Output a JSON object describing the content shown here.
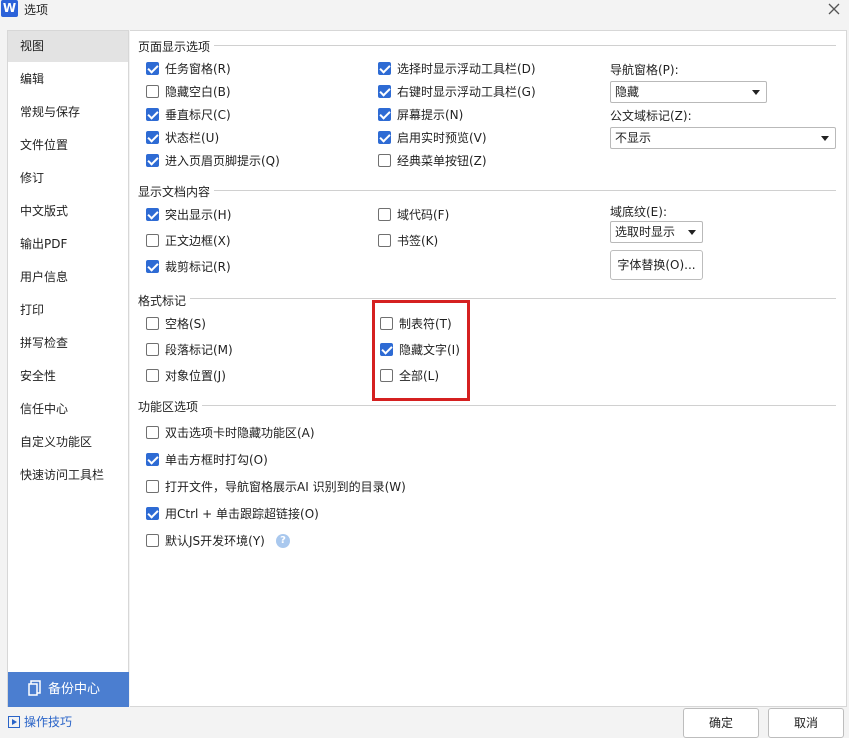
{
  "window": {
    "logo": "W",
    "title": "选项"
  },
  "sidebar": {
    "items": [
      "视图",
      "编辑",
      "常规与保存",
      "文件位置",
      "修订",
      "中文版式",
      "输出PDF",
      "用户信息",
      "打印",
      "拼写检查",
      "安全性",
      "信任中心",
      "自定义功能区",
      "快速访问工具栏"
    ],
    "active_index": 0,
    "backup_label": "备份中心",
    "tips_label": "操作技巧"
  },
  "sections": {
    "page_display": "页面显示选项",
    "doc_content": "显示文档内容",
    "format_marks": "格式标记",
    "ribbon": "功能区选项"
  },
  "page_display": {
    "col1": [
      {
        "label": "任务窗格(R)",
        "checked": true
      },
      {
        "label": "隐藏空白(B)",
        "checked": false
      },
      {
        "label": "垂直标尺(C)",
        "checked": true
      },
      {
        "label": "状态栏(U)",
        "checked": true
      },
      {
        "label": "进入页眉页脚提示(Q)",
        "checked": true
      }
    ],
    "col2": [
      {
        "label": "选择时显示浮动工具栏(D)",
        "checked": true
      },
      {
        "label": "右键时显示浮动工具栏(G)",
        "checked": true
      },
      {
        "label": "屏幕提示(N)",
        "checked": true
      },
      {
        "label": "启用实时预览(V)",
        "checked": true
      },
      {
        "label": "经典菜单按钮(Z)",
        "checked": false
      }
    ],
    "nav_pane_label": "导航窗格(P):",
    "nav_pane_value": "隐藏",
    "field_mark_label": "公文域标记(Z):",
    "field_mark_value": "不显示"
  },
  "doc_content": {
    "col1": [
      {
        "label": "突出显示(H)",
        "checked": true
      },
      {
        "label": "正文边框(X)",
        "checked": false
      },
      {
        "label": "裁剪标记(R)",
        "checked": true
      }
    ],
    "col2": [
      {
        "label": "域代码(F)",
        "checked": false
      },
      {
        "label": "书签(K)",
        "checked": false
      }
    ],
    "shading_label": "域底纹(E):",
    "shading_value": "选取时显示",
    "font_sub_button": "字体替换(O)..."
  },
  "format_marks": {
    "col1": [
      {
        "label": "空格(S)",
        "checked": false
      },
      {
        "label": "段落标记(M)",
        "checked": false
      },
      {
        "label": "对象位置(J)",
        "checked": false
      }
    ],
    "col2": [
      {
        "label": "制表符(T)",
        "checked": false
      },
      {
        "label": "隐藏文字(I)",
        "checked": true
      },
      {
        "label": "全部(L)",
        "checked": false
      }
    ]
  },
  "ribbon": {
    "items": [
      {
        "label": "双击选项卡时隐藏功能区(A)",
        "checked": false
      },
      {
        "label": "单击方框时打勾(O)",
        "checked": true
      },
      {
        "label": "打开文件，导航窗格展示AI 识别到的目录(W)",
        "checked": false
      },
      {
        "label": "用Ctrl + 单击跟踪超链接(O)",
        "checked": true
      },
      {
        "label": "默认JS开发环境(Y)",
        "checked": false
      }
    ],
    "help_glyph": "?"
  },
  "footer": {
    "ok": "确定",
    "cancel": "取消"
  },
  "colors": {
    "accent": "#2e6bd4",
    "backup": "#4b7ed0",
    "highlight": "#d52020"
  }
}
